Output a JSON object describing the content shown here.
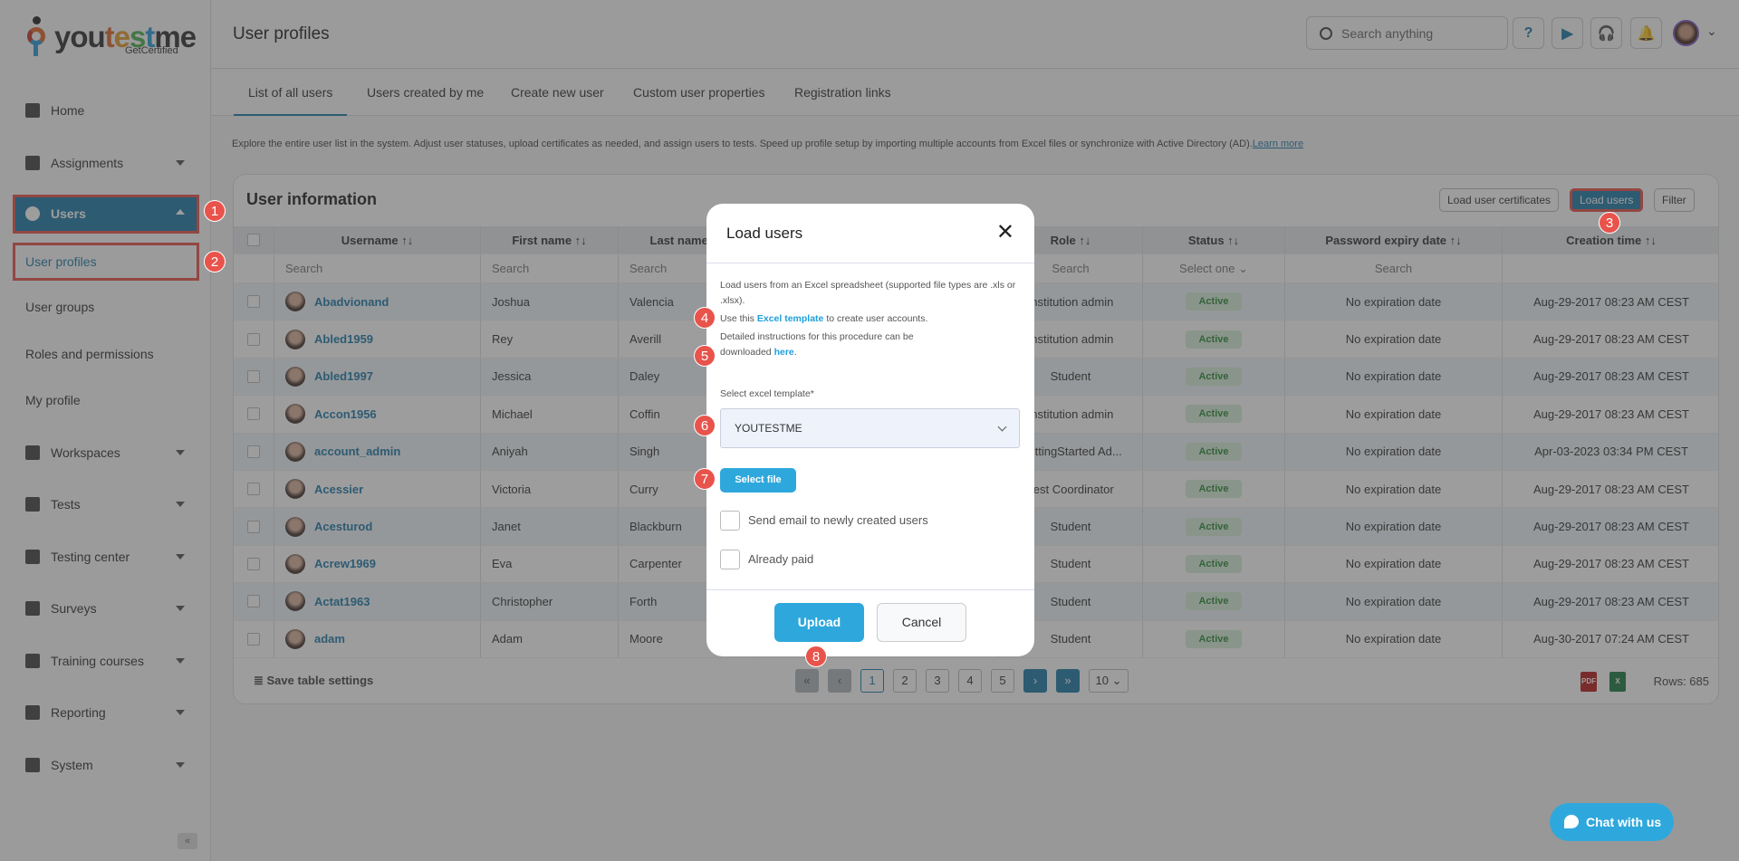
{
  "brand": {
    "name_parts": [
      "you",
      "t",
      "e",
      "s",
      "t",
      "me"
    ],
    "tagline": "GetCertified"
  },
  "sidebar": {
    "items": [
      {
        "label": "Home",
        "icon": "home-icon"
      },
      {
        "label": "Assignments",
        "icon": "dashboard-icon"
      },
      {
        "label": "Users",
        "icon": "users-icon",
        "expanded": true
      },
      {
        "label": "User profiles",
        "sub": true,
        "active": true
      },
      {
        "label": "User groups",
        "sub": true
      },
      {
        "label": "Roles and permissions",
        "sub": true
      },
      {
        "label": "My profile",
        "sub": true
      },
      {
        "label": "Workspaces",
        "icon": "globe-icon"
      },
      {
        "label": "Tests",
        "icon": "tests-icon"
      },
      {
        "label": "Testing center",
        "icon": "calendar-icon"
      },
      {
        "label": "Surveys",
        "icon": "list-icon"
      },
      {
        "label": "Training courses",
        "icon": "trophy-icon"
      },
      {
        "label": "Reporting",
        "icon": "report-icon"
      },
      {
        "label": "System",
        "icon": "gear-icon"
      }
    ],
    "collapse_label": "«"
  },
  "header": {
    "title": "User profiles",
    "search_placeholder": "Search anything",
    "help": "?",
    "play": "▶",
    "support": "🎧",
    "bell": "🔔",
    "chevron": "⌄"
  },
  "tabs": [
    "List of all users",
    "Users created by me",
    "Create new user",
    "Custom user properties",
    "Registration links"
  ],
  "description": {
    "text": "Explore the entire user list in the system. Adjust user statuses, upload certificates as needed, and assign users to tests. Speed up profile setup by importing multiple accounts from Excel files or synchronize with Active Directory (AD).",
    "link": "Learn more"
  },
  "card": {
    "title": "User information",
    "buttons": {
      "certificates": "Load user certificates",
      "load_users": "Load users",
      "filter": "Filter"
    }
  },
  "table": {
    "columns": [
      "Username ↑↓",
      "First name ↑↓",
      "Last name ↑↓",
      "",
      "Role ↑↓",
      "Status ↑↓",
      "Password expiry date ↑↓",
      "Creation time ↑↓"
    ],
    "search": [
      "Search",
      "Search",
      "Search",
      "",
      "Search",
      "Select one ⌄",
      "Search",
      ""
    ],
    "rows": [
      [
        "Abadvionand",
        "Joshua",
        "Valencia",
        "",
        "Institution admin",
        "Active",
        "No expiration date",
        "Aug-29-2017 08:23 AM CEST"
      ],
      [
        "Abled1959",
        "Rey",
        "Averill",
        "",
        "Institution admin",
        "Active",
        "No expiration date",
        "Aug-29-2017 08:23 AM CEST"
      ],
      [
        "Abled1997",
        "Jessica",
        "Daley",
        "",
        "Student",
        "Active",
        "No expiration date",
        "Aug-29-2017 08:23 AM CEST"
      ],
      [
        "Accon1956",
        "Michael",
        "Coffin",
        "",
        "Institution admin",
        "Active",
        "No expiration date",
        "Aug-29-2017 08:23 AM CEST"
      ],
      [
        "account_admin",
        "Aniyah",
        "Singh",
        "",
        "GettingStarted Ad...",
        "Active",
        "No expiration date",
        "Apr-03-2023 03:34 PM CEST"
      ],
      [
        "Acessier",
        "Victoria",
        "Curry",
        "",
        "Test Coordinator",
        "Active",
        "No expiration date",
        "Aug-29-2017 08:23 AM CEST"
      ],
      [
        "Acesturod",
        "Janet",
        "Blackburn",
        "",
        "Student",
        "Active",
        "No expiration date",
        "Aug-29-2017 08:23 AM CEST"
      ],
      [
        "Acrew1969",
        "Eva",
        "Carpenter",
        "",
        "Student",
        "Active",
        "No expiration date",
        "Aug-29-2017 08:23 AM CEST"
      ],
      [
        "Actat1963",
        "Christopher",
        "Forth",
        "",
        "Student",
        "Active",
        "No expiration date",
        "Aug-29-2017 08:23 AM CEST"
      ],
      [
        "adam",
        "Adam",
        "Moore",
        "",
        "Student",
        "Active",
        "No expiration date",
        "Aug-30-2017 07:24 AM CEST"
      ]
    ]
  },
  "footer": {
    "save": "Save table settings",
    "first": "«",
    "prev": "‹",
    "pages": [
      "1",
      "2",
      "3",
      "4",
      "5"
    ],
    "current_page": "1",
    "next": "›",
    "last": "»",
    "page_size": "10 ⌄",
    "pdf": "PDF",
    "excel": "X",
    "rows": "Rows: 685"
  },
  "modal": {
    "title": "Load users",
    "close": "✕",
    "line1": "Load users from an Excel spreadsheet (supported file types are .xls or .xlsx).",
    "line2_pre": "Use this ",
    "line2_link": "Excel template",
    "line2_post": " to create user accounts.",
    "line3_pre": "Detailed instructions for this procedure can be downloaded ",
    "line3_link": "here",
    "select_label": "Select excel template*",
    "select_value": "YOUTESTME",
    "select_file": "Select file",
    "send_email": "Send email to newly created users",
    "already_paid": "Already paid",
    "upload": "Upload",
    "cancel": "Cancel"
  },
  "markers": [
    "1",
    "2",
    "3",
    "4",
    "5",
    "6",
    "7",
    "8"
  ],
  "chat": "Chat with us",
  "colors": {
    "primary": "#1f7aa8",
    "accent": "#2ea8dc",
    "marker": "#e8534b",
    "active_badge": "#2e8b3a"
  }
}
